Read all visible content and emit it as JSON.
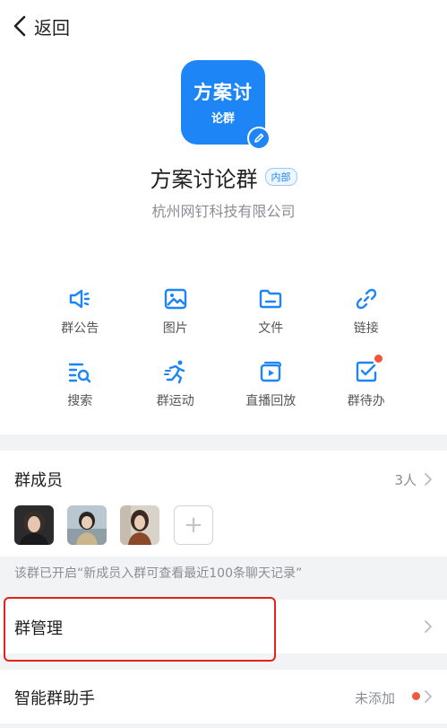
{
  "nav": {
    "back_label": "返回"
  },
  "group": {
    "avatar_line1": "方案讨",
    "avatar_line2": "论群",
    "name": "方案讨论群",
    "badge": "内部",
    "org": "杭州网钉科技有限公司"
  },
  "tools": [
    {
      "label": "群公告",
      "icon": "announcement-icon"
    },
    {
      "label": "图片",
      "icon": "image-icon"
    },
    {
      "label": "文件",
      "icon": "folder-icon"
    },
    {
      "label": "链接",
      "icon": "link-icon"
    },
    {
      "label": "搜索",
      "icon": "search-list-icon"
    },
    {
      "label": "群运动",
      "icon": "running-icon"
    },
    {
      "label": "直播回放",
      "icon": "live-replay-icon"
    },
    {
      "label": "群待办",
      "icon": "todo-check-icon"
    }
  ],
  "members": {
    "title": "群成员",
    "count": "3人",
    "add_label": "+"
  },
  "notice": "该群已开启“新成员入群可查看最近100条聊天记录”",
  "manage": {
    "title": "群管理"
  },
  "assistant": {
    "title": "智能群助手",
    "value": "未添加"
  },
  "colors": {
    "accent": "#1d85f5",
    "red_dot": "#f3573a",
    "highlight": "#e3221c"
  }
}
